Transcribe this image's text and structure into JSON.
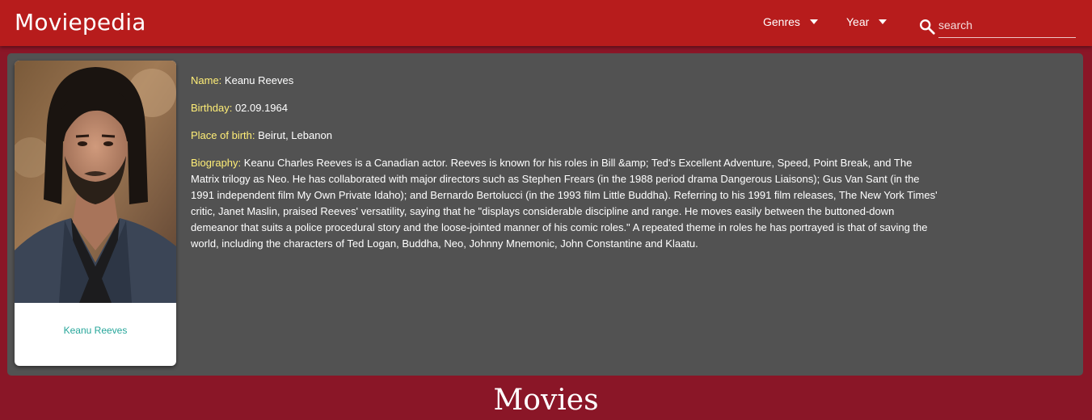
{
  "header": {
    "brand": "Moviepedia",
    "genres_label": "Genres",
    "year_label": "Year",
    "search_placeholder": "search"
  },
  "person": {
    "card_name": "Keanu Reeves",
    "name_label": "Name:",
    "name": "Keanu Reeves",
    "birthday_label": "Birthday:",
    "birthday": "02.09.1964",
    "birthplace_label": "Place of birth:",
    "birthplace": "Beirut, Lebanon",
    "biography_label": "Biography:",
    "biography": "Keanu Charles Reeves is a Canadian actor. Reeves is known for his roles in Bill &amp; Ted's Excellent Adventure, Speed, Point Break, and The Matrix trilogy as Neo. He has collaborated with major directors such as Stephen Frears (in the 1988 period drama Dangerous Liaisons); Gus Van Sant (in the 1991 independent film My Own Private Idaho); and Bernardo Bertolucci (in the 1993 film Little Buddha). Referring to his 1991 film releases, The New York Times' critic, Janet Maslin, praised Reeves' versatility, saying that he \"displays considerable discipline and range. He moves easily between the buttoned-down demeanor that suits a police procedural story and the loose-jointed manner of his comic roles.\" A repeated theme in roles he has portrayed is that of saving the world, including the characters of Ted Logan, Buddha, Neo, Johnny Mnemonic, John Constantine and Klaatu."
  },
  "section": {
    "movies_title": "Movies"
  },
  "colors": {
    "header_bg": "#b71c1c",
    "page_bg": "#8a1627",
    "panel_bg": "#525252",
    "label_color": "#ffee77",
    "card_name_color": "#26a69a"
  },
  "icons": {
    "search": "search-icon",
    "dropdown": "caret-down-icon"
  }
}
